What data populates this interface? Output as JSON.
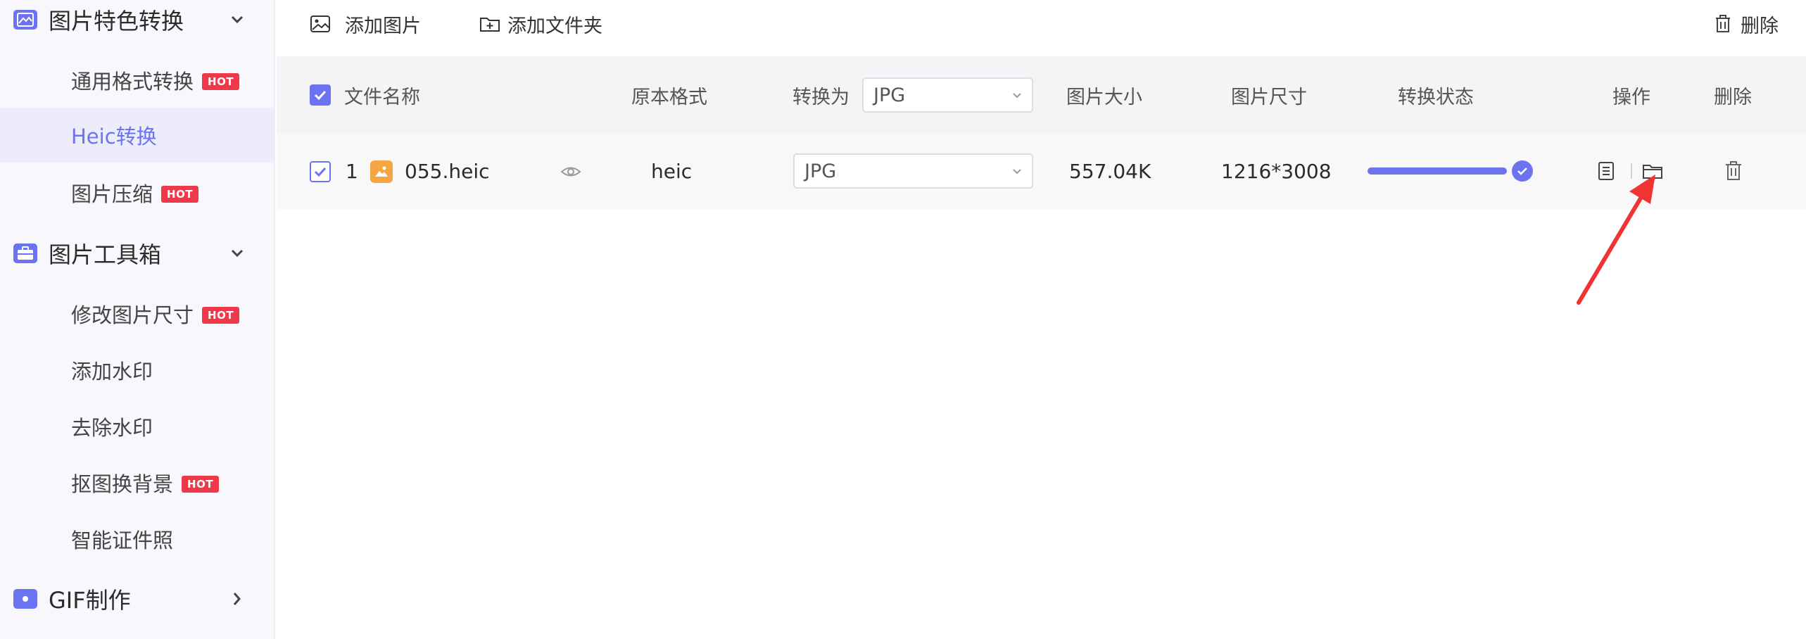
{
  "sidebar": {
    "groups": [
      {
        "label": "图片特色转换",
        "icon": "image-convert-icon",
        "expanded": true
      },
      {
        "label": "图片工具箱",
        "icon": "toolbox-icon",
        "expanded": true
      },
      {
        "label": "GIF制作",
        "icon": "gif-icon",
        "expanded": false
      }
    ],
    "items": [
      {
        "label": "通用格式转换",
        "hot": "HOT"
      },
      {
        "label": "Heic转换",
        "active": true
      },
      {
        "label": "图片压缩",
        "hot": "HOT"
      },
      {
        "label": "修改图片尺寸",
        "hot": "HOT"
      },
      {
        "label": "添加水印"
      },
      {
        "label": "去除水印"
      },
      {
        "label": "抠图换背景",
        "hot": "HOT"
      },
      {
        "label": "智能证件照"
      }
    ]
  },
  "toolbar": {
    "add_image": "添加图片",
    "add_folder": "添加文件夹",
    "delete": "删除"
  },
  "table": {
    "headers": {
      "name": "文件名称",
      "orig_format": "原本格式",
      "convert_to": "转换为",
      "convert_to_value": "JPG",
      "size": "图片大小",
      "dimensions": "图片尺寸",
      "status": "转换状态",
      "ops": "操作",
      "delete": "删除"
    },
    "rows": [
      {
        "index": "1",
        "name": "055.heic",
        "orig_format": "heic",
        "target_format": "JPG",
        "size": "557.04K",
        "dimensions": "1216*3008",
        "progress": 1.0
      }
    ]
  },
  "colors": {
    "accent": "#6b73f0",
    "hot_badge": "#f0384b",
    "annotation_arrow": "#f03434"
  }
}
